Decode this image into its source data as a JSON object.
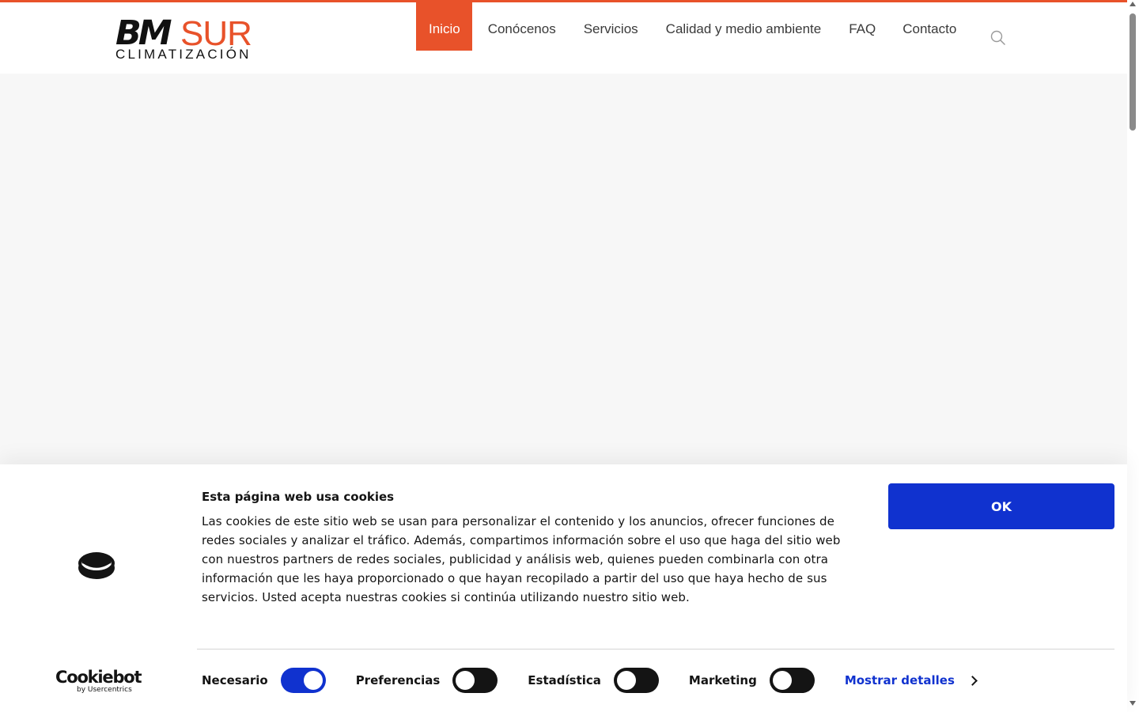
{
  "brand": {
    "logo_bm": "BM",
    "logo_sur": "SUR",
    "logo_sub": "CLIMATIZACIÓN",
    "accent_color": "#e8522a"
  },
  "nav": {
    "items": [
      {
        "label": "Inicio",
        "active": true
      },
      {
        "label": "Conócenos"
      },
      {
        "label": "Servicios"
      },
      {
        "label": "Calidad y medio ambiente"
      },
      {
        "label": "FAQ"
      },
      {
        "label": "Contacto"
      }
    ],
    "search_icon": "search-icon"
  },
  "cookie": {
    "title": "Esta página web usa cookies",
    "body": "Las cookies de este sitio web se usan para personalizar el contenido y los anuncios, ofrecer funciones de redes sociales y analizar el tráfico. Además, compartimos información sobre el uso que haga del sitio web con nuestros partners de redes sociales, publicidad y análisis web, quienes pueden combinarla con otra información que les haya proporcionado o que hayan recopilado a partir del uso que haya hecho de sus servicios. Usted acepta nuestras cookies si continúa utilizando nuestro sitio web.",
    "ok_label": "OK",
    "button_color": "#1032cf",
    "toggles": [
      {
        "label": "Necesario",
        "on": true
      },
      {
        "label": "Preferencias",
        "on": false
      },
      {
        "label": "Estadística",
        "on": false
      },
      {
        "label": "Marketing",
        "on": false
      }
    ],
    "details_label": "Mostrar detalles",
    "provider_name": "Cookiebot",
    "provider_by": "by Usercentrics"
  }
}
